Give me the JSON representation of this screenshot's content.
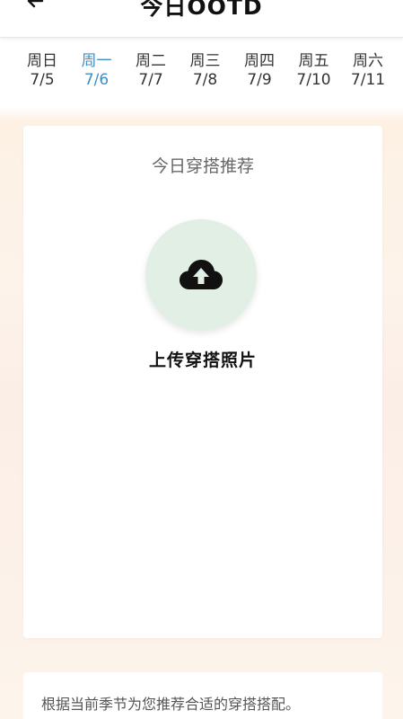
{
  "header": {
    "title": "今日OOTD",
    "back_icon": "arrow-left-icon"
  },
  "week": {
    "selected_index": 1,
    "days": [
      {
        "weekday": "周日",
        "date": "7/5"
      },
      {
        "weekday": "周一",
        "date": "7/6"
      },
      {
        "weekday": "周二",
        "date": "7/7"
      },
      {
        "weekday": "周三",
        "date": "7/8"
      },
      {
        "weekday": "周四",
        "date": "7/9"
      },
      {
        "weekday": "周五",
        "date": "7/10"
      },
      {
        "weekday": "周六",
        "date": "7/11"
      }
    ],
    "active_color": "#3d8fc4"
  },
  "card": {
    "title": "今日穿搭推荐",
    "upload_icon": "cloud-upload-icon",
    "upload_label": "上传穿搭照片"
  },
  "note": {
    "text": "根据当前季节为您推荐合适的穿搭搭配。"
  }
}
